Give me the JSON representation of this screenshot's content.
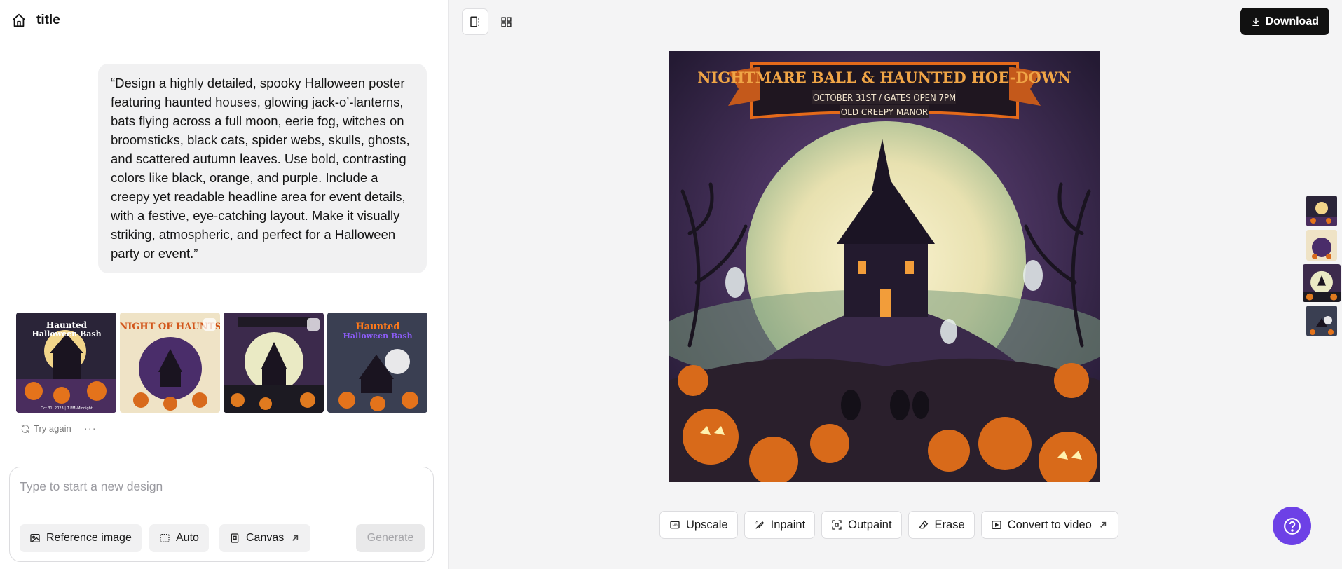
{
  "header": {
    "title": "title"
  },
  "prompt": {
    "text": "“Design a highly detailed, spooky Halloween poster featuring haunted houses, glowing jack-o’-lanterns, bats flying across a full moon, eerie fog, witches on broomsticks, black cats, spider webs, skulls, ghosts, and scattered autumn leaves. Use bold, contrasting colors like black, orange, and purple. Include a creepy yet readable headline area for event details, with a festive, eye-catching layout. Make it visually striking, atmospheric, and perfect for a Halloween party or event.”"
  },
  "results": {
    "thumbnails": [
      {
        "icon": "poster-thumbnail",
        "text": [
          "Haunted",
          "Halloween Bash",
          "Oct 31, 2023 | 7 PM–Midnight"
        ]
      },
      {
        "icon": "poster-thumbnail",
        "text": [
          "NIGHT OF HAUNTS"
        ]
      },
      {
        "icon": "poster-thumbnail",
        "text": []
      },
      {
        "icon": "poster-thumbnail",
        "text": [
          "Haunted",
          "Halloween Bash"
        ]
      }
    ],
    "try_again_label": "Try again",
    "more_label": "···"
  },
  "composer": {
    "placeholder": "Type to start a new design",
    "reference_label": "Reference image",
    "auto_label": "Auto",
    "canvas_label": "Canvas",
    "generate_label": "Generate"
  },
  "toolbar": {
    "download_label": "Download"
  },
  "poster": {
    "title": "NIGHTMARE BALL & HAUNTED HOE-DOWN",
    "date_line": "OCTOBER 31ST / GATES OPEN 7PM",
    "venue_line": "OLD CREEPY MANOR"
  },
  "tools": [
    {
      "label": "Upscale",
      "icon": "upscale-icon"
    },
    {
      "label": "Inpaint",
      "icon": "inpaint-icon"
    },
    {
      "label": "Outpaint",
      "icon": "outpaint-icon"
    },
    {
      "label": "Erase",
      "icon": "erase-icon"
    },
    {
      "label": "Convert to video",
      "icon": "video-icon"
    }
  ],
  "colors": {
    "accent": "#6d41e6",
    "download_bg": "#111111",
    "poster_orange": "#e46a1a",
    "poster_purple": "#5b3a7a"
  }
}
